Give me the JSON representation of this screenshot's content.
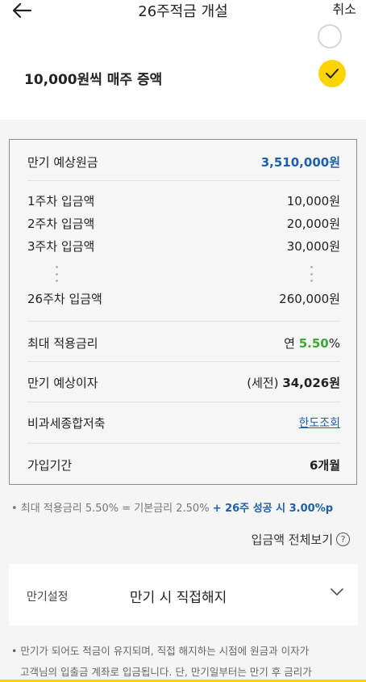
{
  "header": {
    "title": "26주적금 개설",
    "cancel_label": "취소"
  },
  "option": {
    "label": "10,000원씩 매주 증액"
  },
  "summary": {
    "expected_principal_label": "만기 예상원금",
    "expected_principal_value": "3,510,000원",
    "weeks": [
      {
        "label": "1주차 입금액",
        "value": "10,000원"
      },
      {
        "label": "2주차 입금액",
        "value": "20,000원"
      },
      {
        "label": "3주차 입금액",
        "value": "30,000원"
      },
      {
        "label": "26주차 입금액",
        "value": "260,000원"
      }
    ],
    "max_rate_label": "최대 적용금리",
    "max_rate_prefix": "연",
    "max_rate_value": "5.50",
    "max_rate_suffix": "%",
    "expected_interest_label": "만기 예상이자",
    "expected_interest_prefix": "(세전)",
    "expected_interest_value": "34,026원",
    "tax_free_label": "비과세종합저축",
    "tax_free_link": "한도조회",
    "period_label": "가입기간",
    "period_value": "6개월"
  },
  "note": {
    "text": "• 최대 적용금리 5.50% = 기본금리 2.50%",
    "highlight": "+ 26주 성공 시 3.00%p"
  },
  "view_all": {
    "label": "입금액 전체보기",
    "help_symbol": "?"
  },
  "maturity": {
    "label": "만기설정",
    "value": "만기 시 직접해지"
  },
  "bottom_note": {
    "line1": "• 만기가 되어도 적금이 유지되며, 직접 해지하는 시점에 원금과 이자가",
    "line2": "고객님의 입출금 계좌로 입금됩니다. 단, 만기일부터는 만기 후 금리가"
  },
  "colors": {
    "accent_yellow": "#fcd400",
    "link_blue": "#1f5fa8",
    "rate_green": "#3aa935"
  }
}
